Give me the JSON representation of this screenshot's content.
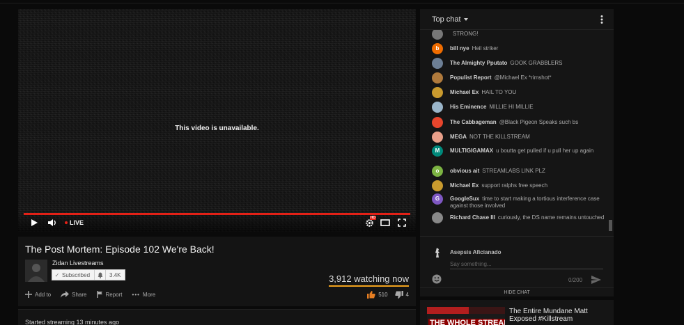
{
  "player": {
    "message": "This video is unavailable.",
    "live_label": "LIVE",
    "hd_badge": "HD"
  },
  "video": {
    "title": "The Post Mortem: Episode 102 We're Back!",
    "channel": "Zidan Livestreams",
    "subscribed_label": "Subscribed",
    "subscriber_count": "3.4K",
    "watching": "3,912 watching now",
    "actions": {
      "add_to": "Add to",
      "share": "Share",
      "report": "Report",
      "more": "More"
    },
    "likes": "510",
    "dislikes": "4",
    "started": "Started streaming 13 minutes ago"
  },
  "chat": {
    "header": "Top chat",
    "messages": [
      {
        "author": "",
        "text": "STRONG!",
        "avatar_color": "#777777",
        "initial": ""
      },
      {
        "author": "bill nye",
        "text": "Heil striker",
        "avatar_color": "#ef6c00",
        "initial": "b"
      },
      {
        "author": "The Almighty Pputato",
        "text": "GOOK GRABBLERS",
        "avatar_color": "#6d7f95",
        "initial": ""
      },
      {
        "author": "Populist Report",
        "text": "@Michael Ex *rimshot*",
        "avatar_color": "#b07a3c",
        "initial": ""
      },
      {
        "author": "Michael Ex",
        "text": "HAIL TO YOU",
        "avatar_color": "#c99a2e",
        "initial": ""
      },
      {
        "author": "His Eminence",
        "text": "MILLIE HI MILLIE",
        "avatar_color": "#9ab5c9",
        "initial": ""
      },
      {
        "author": "The Cabbageman",
        "text": "@Black Pigeon Speaks such bs",
        "avatar_color": "#e8452c",
        "initial": ""
      },
      {
        "author": "MEGA",
        "text": "NOT THE KILLSTREAM",
        "avatar_color": "#e9a08a",
        "initial": ""
      },
      {
        "author": "MULTIGIGAMAX",
        "text": "u boutta get pulled if u pull her up again",
        "avatar_color": "#00897b",
        "initial": "M"
      },
      {
        "author": "obvious ait",
        "text": "STREAMLABS LINK PLZ",
        "avatar_color": "#7cb342",
        "initial": "o"
      },
      {
        "author": "Michael Ex",
        "text": "support ralphs free speech",
        "avatar_color": "#c99a2e",
        "initial": ""
      },
      {
        "author": "GoogleSux",
        "text": "time to start making a tortious interference case against those involved",
        "avatar_color": "#7e57c2",
        "initial": "G"
      },
      {
        "author": "Richard Chase III",
        "text": "curiously, the DS name remains untouched",
        "avatar_color": "#888888",
        "initial": ""
      }
    ],
    "current_user": "Asepsis Aficianado",
    "placeholder": "Say something...",
    "char_count": "0/200",
    "hide_label": "HIDE CHAT"
  },
  "recommendation": {
    "thumb_text": "THE WHOLE STREAM",
    "title": "The Entire Mundane Matt Exposed #Killstream"
  }
}
